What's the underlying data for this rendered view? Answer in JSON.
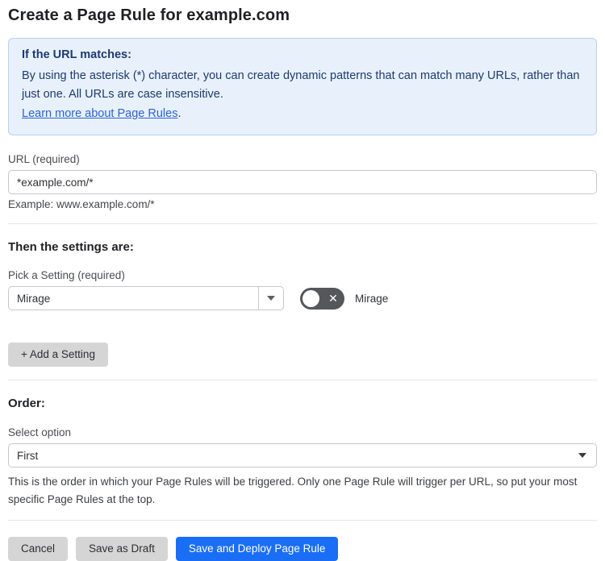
{
  "page": {
    "title": "Create a Page Rule for example.com"
  },
  "info_box": {
    "heading": "If the URL matches:",
    "body": "By using the asterisk (*) character, you can create dynamic patterns that can match many URLs, rather than just one. All URLs are case insensitive.",
    "link_label": "Learn more about Page Rules",
    "link_suffix": "."
  },
  "url_field": {
    "label": "URL (required)",
    "value": "*example.com/*",
    "example": "Example: www.example.com/*"
  },
  "settings_section": {
    "heading": "Then the settings are:",
    "pick_label": "Pick a Setting (required)",
    "selected_setting": "Mirage",
    "toggle": {
      "state": "off",
      "off_glyph": "✕",
      "label": "Mirage"
    },
    "add_button_label": "+ Add a Setting"
  },
  "order_section": {
    "heading": "Order:",
    "label": "Select option",
    "selected_option": "First",
    "help": "This is the order in which your Page Rules will be triggered. Only one Page Rule will trigger per URL, so put your most specific Page Rules at the top."
  },
  "footer": {
    "cancel_label": "Cancel",
    "save_draft_label": "Save as Draft",
    "save_deploy_label": "Save and Deploy Page Rule"
  },
  "colors": {
    "primary_blue": "#1a6ef5",
    "info_background": "#e8f1fb",
    "info_border": "#b5d1ef",
    "info_text": "#1e3a70",
    "link_blue": "#2b62d9",
    "toggle_off_gray": "#55575b",
    "button_gray": "#d5d5d6"
  }
}
